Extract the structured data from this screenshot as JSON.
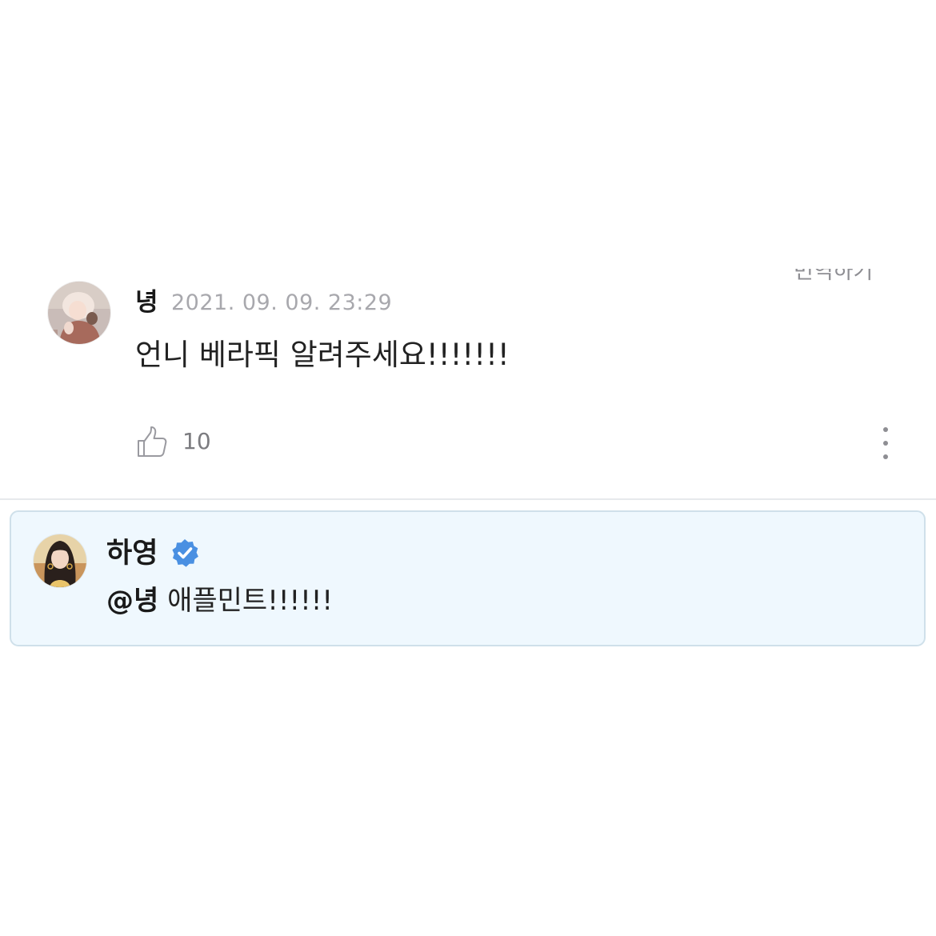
{
  "comment": {
    "author": "녕",
    "timestamp": "2021. 09. 09. 23:29",
    "translate_label": "번역하기",
    "body": "언니 베라픽 알려주세요!!!!!!!",
    "like_count": "10",
    "avatar_icon": "user-avatar"
  },
  "reply": {
    "author": "하영",
    "verified_icon": "verified-badge-icon",
    "mention": "@녕",
    "body": " 애플민트!!!!!!",
    "accent_color": "#4a90e2",
    "background_color": "#eff8fe"
  }
}
